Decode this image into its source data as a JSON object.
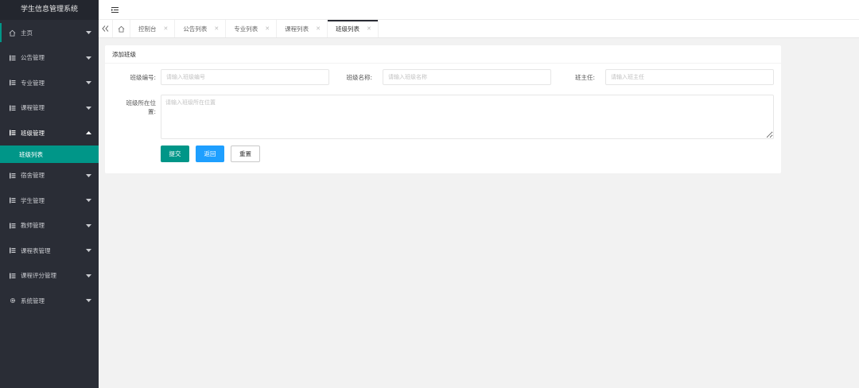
{
  "app": {
    "title": "学生信息管理系统"
  },
  "sidebar": {
    "items": [
      {
        "label": "主页",
        "icon": "home-icon",
        "arrow": "down"
      },
      {
        "label": "公告管理",
        "icon": "list-icon",
        "arrow": "down"
      },
      {
        "label": "专业管理",
        "icon": "list-icon",
        "arrow": "down"
      },
      {
        "label": "课程管理",
        "icon": "list-icon",
        "arrow": "down"
      },
      {
        "label": "班级管理",
        "icon": "list-icon",
        "arrow": "up",
        "sub": [
          {
            "label": "班级列表",
            "active": true
          }
        ]
      },
      {
        "label": "宿舍管理",
        "icon": "list-icon",
        "arrow": "down"
      },
      {
        "label": "学生管理",
        "icon": "list-icon",
        "arrow": "down"
      },
      {
        "label": "教师管理",
        "icon": "list-icon",
        "arrow": "down"
      },
      {
        "label": "课程表管理",
        "icon": "list-icon",
        "arrow": "down"
      },
      {
        "label": "课程评分管理",
        "icon": "list-icon",
        "arrow": "down"
      },
      {
        "label": "系统管理",
        "icon": "gear-icon",
        "arrow": "down"
      }
    ]
  },
  "tabs": [
    {
      "label": "控制台",
      "active": false
    },
    {
      "label": "公告列表",
      "active": false
    },
    {
      "label": "专业列表",
      "active": false
    },
    {
      "label": "课程列表",
      "active": false
    },
    {
      "label": "班级列表",
      "active": true
    }
  ],
  "form": {
    "title": "添加班级",
    "class_no": {
      "label": "班级编号:",
      "placeholder": "请输入班级编号",
      "value": ""
    },
    "class_name": {
      "label": "班级名称:",
      "placeholder": "请输入班级名称",
      "value": ""
    },
    "head_teacher": {
      "label": "班主任:",
      "placeholder": "请输入班主任",
      "value": ""
    },
    "location": {
      "label_line1": "班级所在位",
      "label_line2": "置:",
      "placeholder": "请输入班级所在位置",
      "value": ""
    },
    "buttons": {
      "submit": "提交",
      "back": "返回",
      "reset": "重置"
    }
  },
  "colors": {
    "accent": "#009688",
    "blue": "#1e9fff",
    "sidebar_bg": "#2a2d36"
  }
}
